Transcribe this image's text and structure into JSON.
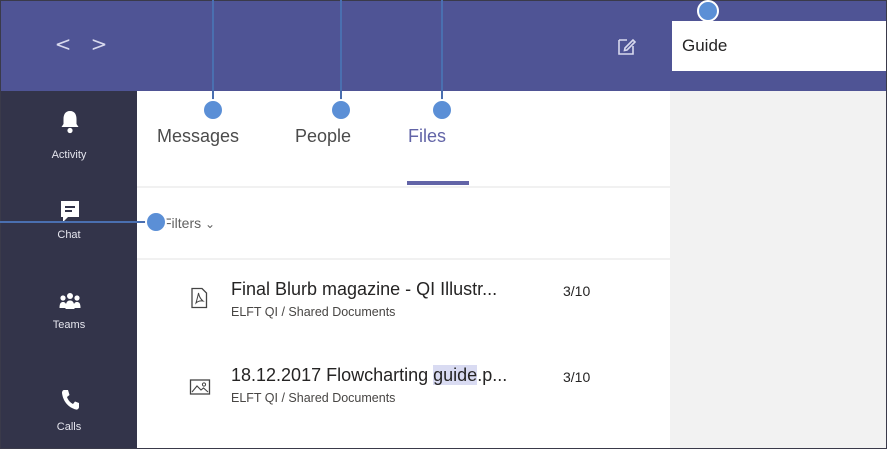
{
  "topbar": {
    "back_glyph": "<",
    "forward_glyph": ">",
    "compose_icon": "compose-icon",
    "search_value": "Guide"
  },
  "rail": {
    "items": [
      {
        "label": "Activity",
        "icon": "bell-icon"
      },
      {
        "label": "Chat",
        "icon": "chat-icon"
      },
      {
        "label": "Teams",
        "icon": "teams-icon"
      },
      {
        "label": "Calls",
        "icon": "phone-icon"
      }
    ]
  },
  "tabs": [
    {
      "label": "Messages",
      "active": false
    },
    {
      "label": "People",
      "active": false
    },
    {
      "label": "Files",
      "active": true
    }
  ],
  "filters": {
    "label": "Filters",
    "chevron": "⌄"
  },
  "files": [
    {
      "icon": "pdf-file-icon",
      "name": "Final Blurb magazine - QI Illustr...",
      "date": "3/10",
      "path": "ELFT QI / Shared Documents"
    },
    {
      "icon": "image-file-icon",
      "name_before": "18.12.2017 Flowcharting ",
      "name_highlight": "guide",
      "name_after": ".p...",
      "date": "3/10",
      "path": "ELFT QI / Shared Documents"
    }
  ],
  "colors": {
    "topbar": "#4f5495",
    "rail": "#33344a",
    "accent": "#6264a7",
    "callout": "#5b8fd6",
    "highlight": "#d9dbf2",
    "right_pane": "#f2f2f2"
  }
}
